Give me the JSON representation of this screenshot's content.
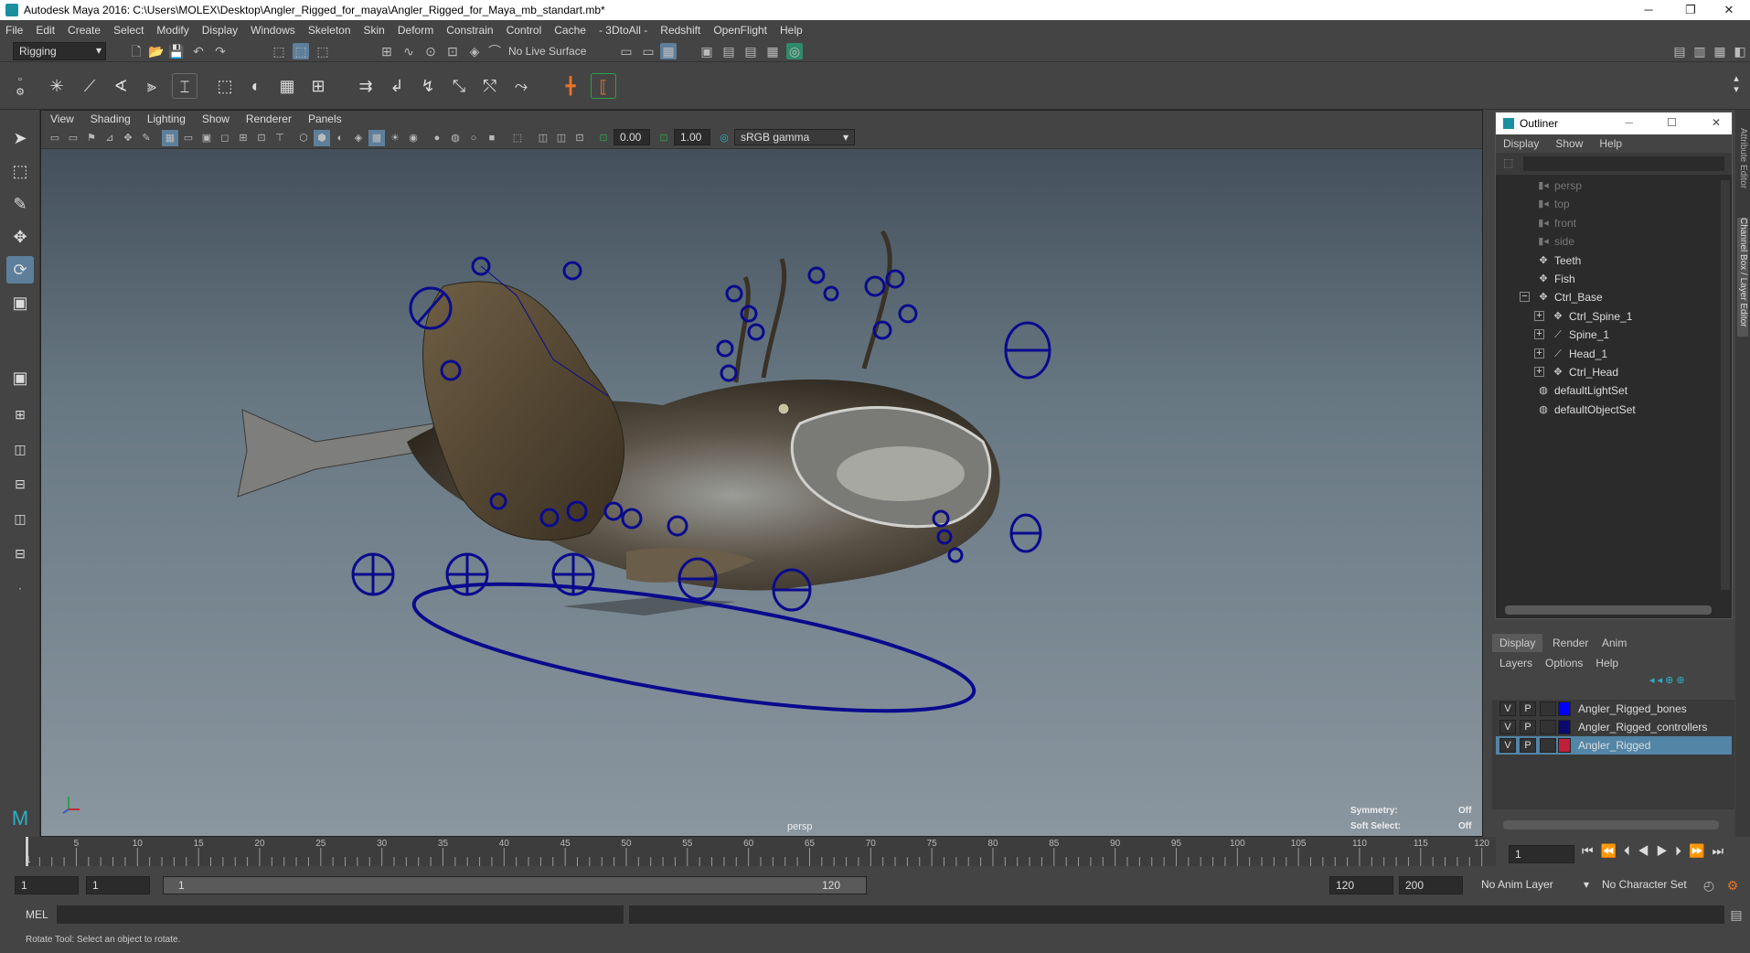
{
  "window": {
    "title": "Autodesk Maya 2016: C:\\Users\\MOLEX\\Desktop\\Angler_Rigged_for_maya\\Angler_Rigged_for_Maya_mb_standart.mb*"
  },
  "menubar": [
    "File",
    "Edit",
    "Create",
    "Select",
    "Modify",
    "Display",
    "Windows",
    "Skeleton",
    "Skin",
    "Deform",
    "Constrain",
    "Control",
    "Cache",
    "- 3DtoAll -",
    "Redshift",
    "OpenFlight",
    "Help"
  ],
  "statusline": {
    "menuset": "Rigging",
    "live_surface": "No Live Surface"
  },
  "viewport": {
    "menu": [
      "View",
      "Shading",
      "Lighting",
      "Show",
      "Renderer",
      "Panels"
    ],
    "exposure": "0.00",
    "gamma": "1.00",
    "colorspace": "sRGB gamma",
    "camera_label": "persp",
    "symmetry_label": "Symmetry:",
    "symmetry_value": "Off",
    "soft_select_label": "Soft Select:",
    "soft_select_value": "Off"
  },
  "outliner": {
    "title": "Outliner",
    "menu": [
      "Display",
      "Show",
      "Help"
    ],
    "items": [
      {
        "label": "persp",
        "icon": "camera-icon",
        "dim": true,
        "indent": 0
      },
      {
        "label": "top",
        "icon": "camera-icon",
        "dim": true,
        "indent": 0
      },
      {
        "label": "front",
        "icon": "camera-icon",
        "dim": true,
        "indent": 0
      },
      {
        "label": "side",
        "icon": "camera-icon",
        "dim": true,
        "indent": 0
      },
      {
        "label": "Teeth",
        "icon": "transform-icon",
        "dim": false,
        "indent": 0
      },
      {
        "label": "Fish",
        "icon": "transform-icon",
        "dim": false,
        "indent": 0
      },
      {
        "label": "Ctrl_Base",
        "icon": "transform-icon",
        "dim": false,
        "indent": 0,
        "expander": "−"
      },
      {
        "label": "Ctrl_Spine_1",
        "icon": "transform-icon",
        "dim": false,
        "indent": 1,
        "expander": "+"
      },
      {
        "label": "Spine_1",
        "icon": "joint-icon",
        "dim": false,
        "indent": 1,
        "expander": "+"
      },
      {
        "label": "Head_1",
        "icon": "joint-icon",
        "dim": false,
        "indent": 1,
        "expander": "+"
      },
      {
        "label": "Ctrl_Head",
        "icon": "transform-icon",
        "dim": false,
        "indent": 1,
        "expander": "+"
      },
      {
        "label": "defaultLightSet",
        "icon": "set-icon",
        "dim": false,
        "indent": 0
      },
      {
        "label": "defaultObjectSet",
        "icon": "set-icon",
        "dim": false,
        "indent": 0
      }
    ]
  },
  "layer_editor": {
    "tabs": [
      "Display",
      "Render",
      "Anim"
    ],
    "menu": [
      "Layers",
      "Options",
      "Help"
    ],
    "layers": [
      {
        "v": "V",
        "p": "P",
        "color": "#0000ff",
        "name": "Angler_Rigged_bones",
        "selected": false
      },
      {
        "v": "V",
        "p": "P",
        "color": "#0a0a6e",
        "name": "Angler_Rigged_controllers",
        "selected": false
      },
      {
        "v": "V",
        "p": "P",
        "color": "#c0203a",
        "name": "Angler_Rigged",
        "selected": true
      }
    ]
  },
  "timeline": {
    "ticks": [
      "5",
      "10",
      "15",
      "20",
      "25",
      "30",
      "35",
      "40",
      "45",
      "50",
      "55",
      "60",
      "65",
      "70",
      "75",
      "80",
      "85",
      "90",
      "95",
      "100",
      "105",
      "110",
      "115",
      "120"
    ],
    "start_label": "1",
    "current_frame": "1"
  },
  "rangebar": {
    "start": "1",
    "playback_start": "1",
    "slider_start": "1",
    "slider_end": "120",
    "playback_end": "120",
    "end": "200",
    "anim_layer": "No Anim Layer",
    "character_set": "No Character Set"
  },
  "cmdline": {
    "label": "MEL"
  },
  "helpline": {
    "text": "Rotate Tool: Select an object to rotate."
  }
}
